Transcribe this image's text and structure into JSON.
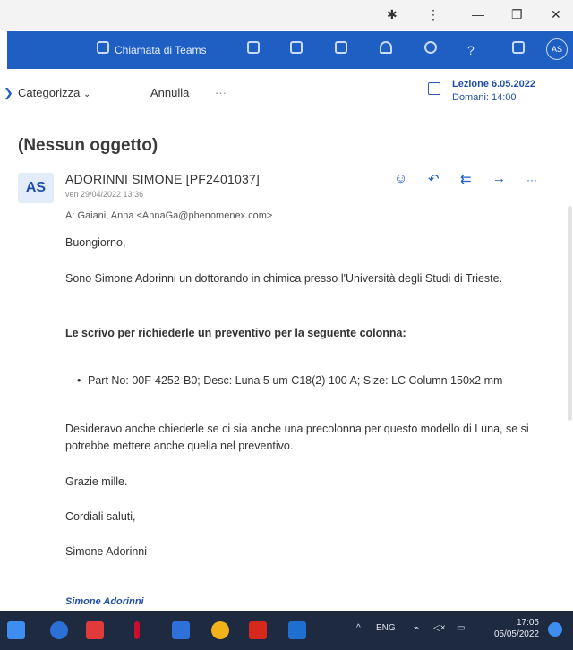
{
  "window": {
    "controls": [
      "⋮",
      "—",
      "❐",
      "✕"
    ],
    "extension_icon": "puzzle-icon"
  },
  "teams_bar": {
    "call_label": "Chiamata di Teams",
    "avatar_initials": "AS",
    "icons": [
      "video-camera-icon",
      "chat-icon",
      "office-icon",
      "forward-icon",
      "bell-icon",
      "gear-icon",
      "help-icon",
      "megaphone-icon"
    ]
  },
  "command_bar": {
    "categorize": "Categorizza",
    "cancel": "Annulla",
    "more": "···",
    "lesson_title": "Lezione 6.05.2022",
    "lesson_time": "Domani: 14:00"
  },
  "message": {
    "subject": "(Nessun oggetto)",
    "avatar": "AS",
    "sender": "ADORINNI SIMONE [PF2401037]",
    "date": "ven 29/04/2022 13:36",
    "to": "A: Gaiani, Anna <AnnaGa@phenomenex.com>",
    "greeting": "Buongiorno,",
    "intro": "Sono Simone Adorinni un dottorando in chimica presso l'Università degli Studi di Trieste.",
    "request": "Le scrivo per richiederle un preventivo per la seguente colonna:",
    "bullet": "Part No: 00F-4252-B0; Desc: Luna 5 um C18(2) 100 A; Size: LC Column 150x2 mm",
    "extra": "Desideravo anche chiederle se ci sia anche una precolonna per questo modello di Luna, se si potrebbe mettere anche quella nel preventivo.",
    "thanks": "Grazie mille.",
    "regards": "Cordiali saluti,",
    "name": "Simone Adorinni",
    "signature": "Simone Adorinni"
  },
  "taskbar": {
    "lang": "ENG",
    "time": "17:05",
    "date": "05/05/2022"
  },
  "colors": {
    "teams_blue": "#1f5fc4",
    "taskbar": "#1e2a40",
    "accent": "#1f4ea8"
  }
}
